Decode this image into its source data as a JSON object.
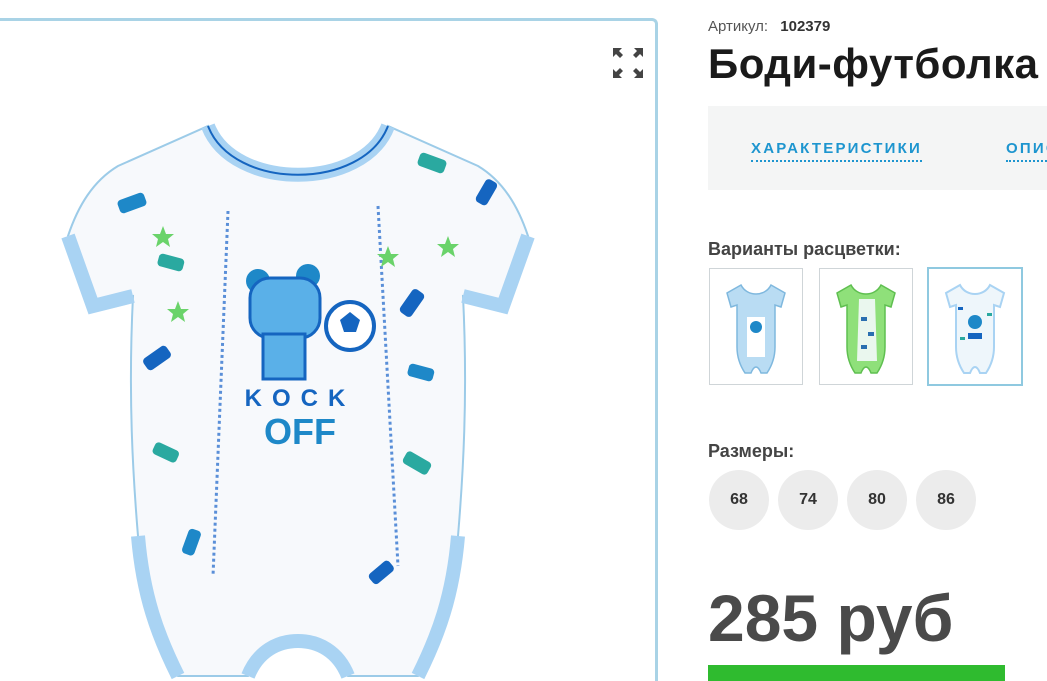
{
  "product": {
    "sku_label": "Артикул:",
    "sku_value": "102379",
    "title": "Боди-футболка",
    "price": "285 руб"
  },
  "tabs": [
    {
      "label": "ХАРАКТЕРИСТИКИ"
    },
    {
      "label": "ОПИСАНИЕ"
    }
  ],
  "colors": {
    "heading": "Варианты расцветки:",
    "options": [
      {
        "name": "light-blue",
        "color": "#b9dcf3"
      },
      {
        "name": "green",
        "color": "#8fe07a"
      },
      {
        "name": "white-print",
        "color": "#eef6fb",
        "selected": true
      }
    ]
  },
  "sizes": {
    "heading": "Размеры:",
    "options": [
      "68",
      "74",
      "80",
      "86"
    ]
  },
  "image": {
    "print_text_top": "KOCK",
    "print_text_bottom": "OFF",
    "trim_color": "#a9d3f3",
    "print_color": "#1565c0"
  },
  "icons": {
    "fullscreen": "expand-arrows-icon"
  },
  "colors_theme": {
    "accent": "#1d95cf",
    "buy": "#2fbb2f",
    "gallery_border": "#a9d3e6"
  }
}
